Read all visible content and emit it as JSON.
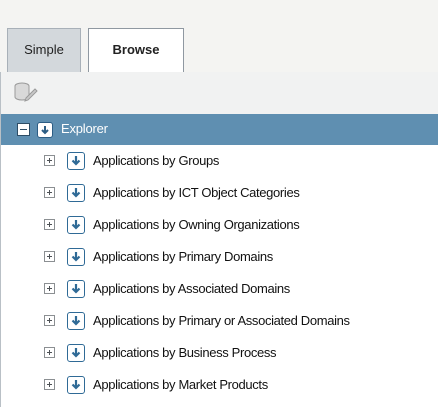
{
  "tabs": [
    {
      "label": "Simple",
      "active": false
    },
    {
      "label": "Browse",
      "active": true
    }
  ],
  "toolbar": {
    "icon": "database-edit-icon"
  },
  "tree": {
    "root": {
      "label": "Explorer",
      "expanded": true
    },
    "items": [
      {
        "label": "Applications by Groups"
      },
      {
        "label": "Applications by ICT Object Categories"
      },
      {
        "label": "Applications by Owning Organizations"
      },
      {
        "label": "Applications by Primary Domains"
      },
      {
        "label": "Applications by Associated Domains"
      },
      {
        "label": "Applications by Primary or Associated Domains"
      },
      {
        "label": "Applications by Business Process"
      },
      {
        "label": "Applications by Market Products"
      }
    ]
  },
  "colors": {
    "selected_row": "#5f8fb1",
    "icon_blue": "#2f6a96"
  }
}
